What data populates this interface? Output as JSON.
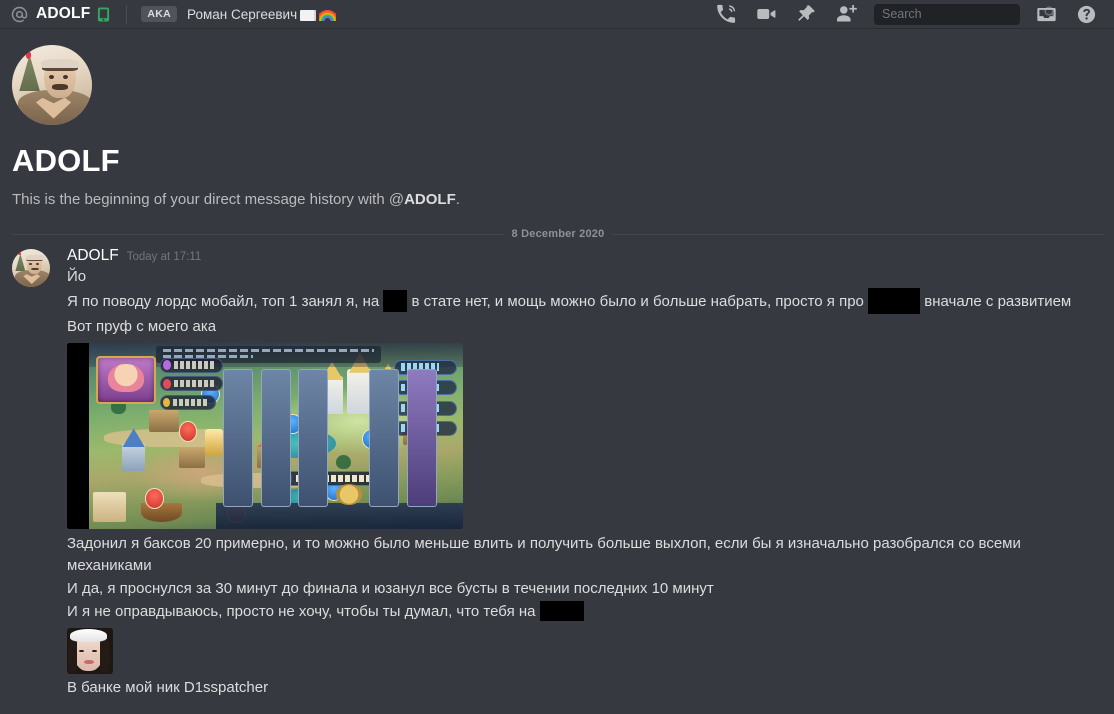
{
  "topbar": {
    "at_icon": "at-icon",
    "dm_title": "ADOLF",
    "mobile_status_icon": "mobile-phone-icon",
    "aka_badge": "AKA",
    "aka_name": "Роман Сергеевич",
    "aka_emoji_flag": "white-flag-emoji",
    "aka_emoji_rainbow": "rainbow-emoji",
    "icons": {
      "call": "phone-call-icon",
      "video": "video-camera-icon",
      "pin": "pin-icon",
      "add_friend": "add-person-icon",
      "inbox": "inbox-icon",
      "help": "help-circle-icon",
      "search": "search-icon"
    },
    "search_placeholder": "Search",
    "search_value": ""
  },
  "intro": {
    "avatar": "user-avatar-adolf",
    "name": "ADOLF",
    "sub_prefix": "This is the beginning of your direct message history with @",
    "sub_name": "ADOLF",
    "sub_suffix": "."
  },
  "divider": {
    "date": "8 December 2020"
  },
  "message": {
    "avatar": "user-avatar-adolf",
    "author": "ADOLF",
    "timestamp": "Today at 17:11",
    "lines": {
      "l1": "Йо",
      "l2_a": "Я по поводу лордс мобайл, топ 1 занял я, на",
      "l2_b": "в стате нет, и мощь можно было и больше набрать, просто я про",
      "l2_c": "вначале с развитием",
      "l3": "Вот пруф с моего ака",
      "l4": "Задонил я баксов 20 примерно, и то можно было меньше влить и получить больше выхлоп, если бы я изначально разобрался со всеми механиками",
      "l5": "И да, я проснулся за 30 минут до финала и юзанул все бусты в течении последних 10 минут",
      "l6_a": "И я не оправдываюсь, просто не хочу, чтобы ты думал, что тебя на",
      "l7": "В банке мой ник D1sspatcher"
    },
    "attachments": {
      "game_screenshot": "lords-mobile-game-screenshot",
      "sticker": "selfie-sticker-image"
    }
  },
  "colors": {
    "app_bg": "#36393f",
    "topbar_bg": "#36393f",
    "text_primary": "#dcddde",
    "text_muted": "#72767d",
    "white": "#ffffff",
    "search_bg": "#202225",
    "badge_bg": "#4f545c",
    "online_mobile_green": "#3ba55d",
    "redaction": "#000000"
  }
}
